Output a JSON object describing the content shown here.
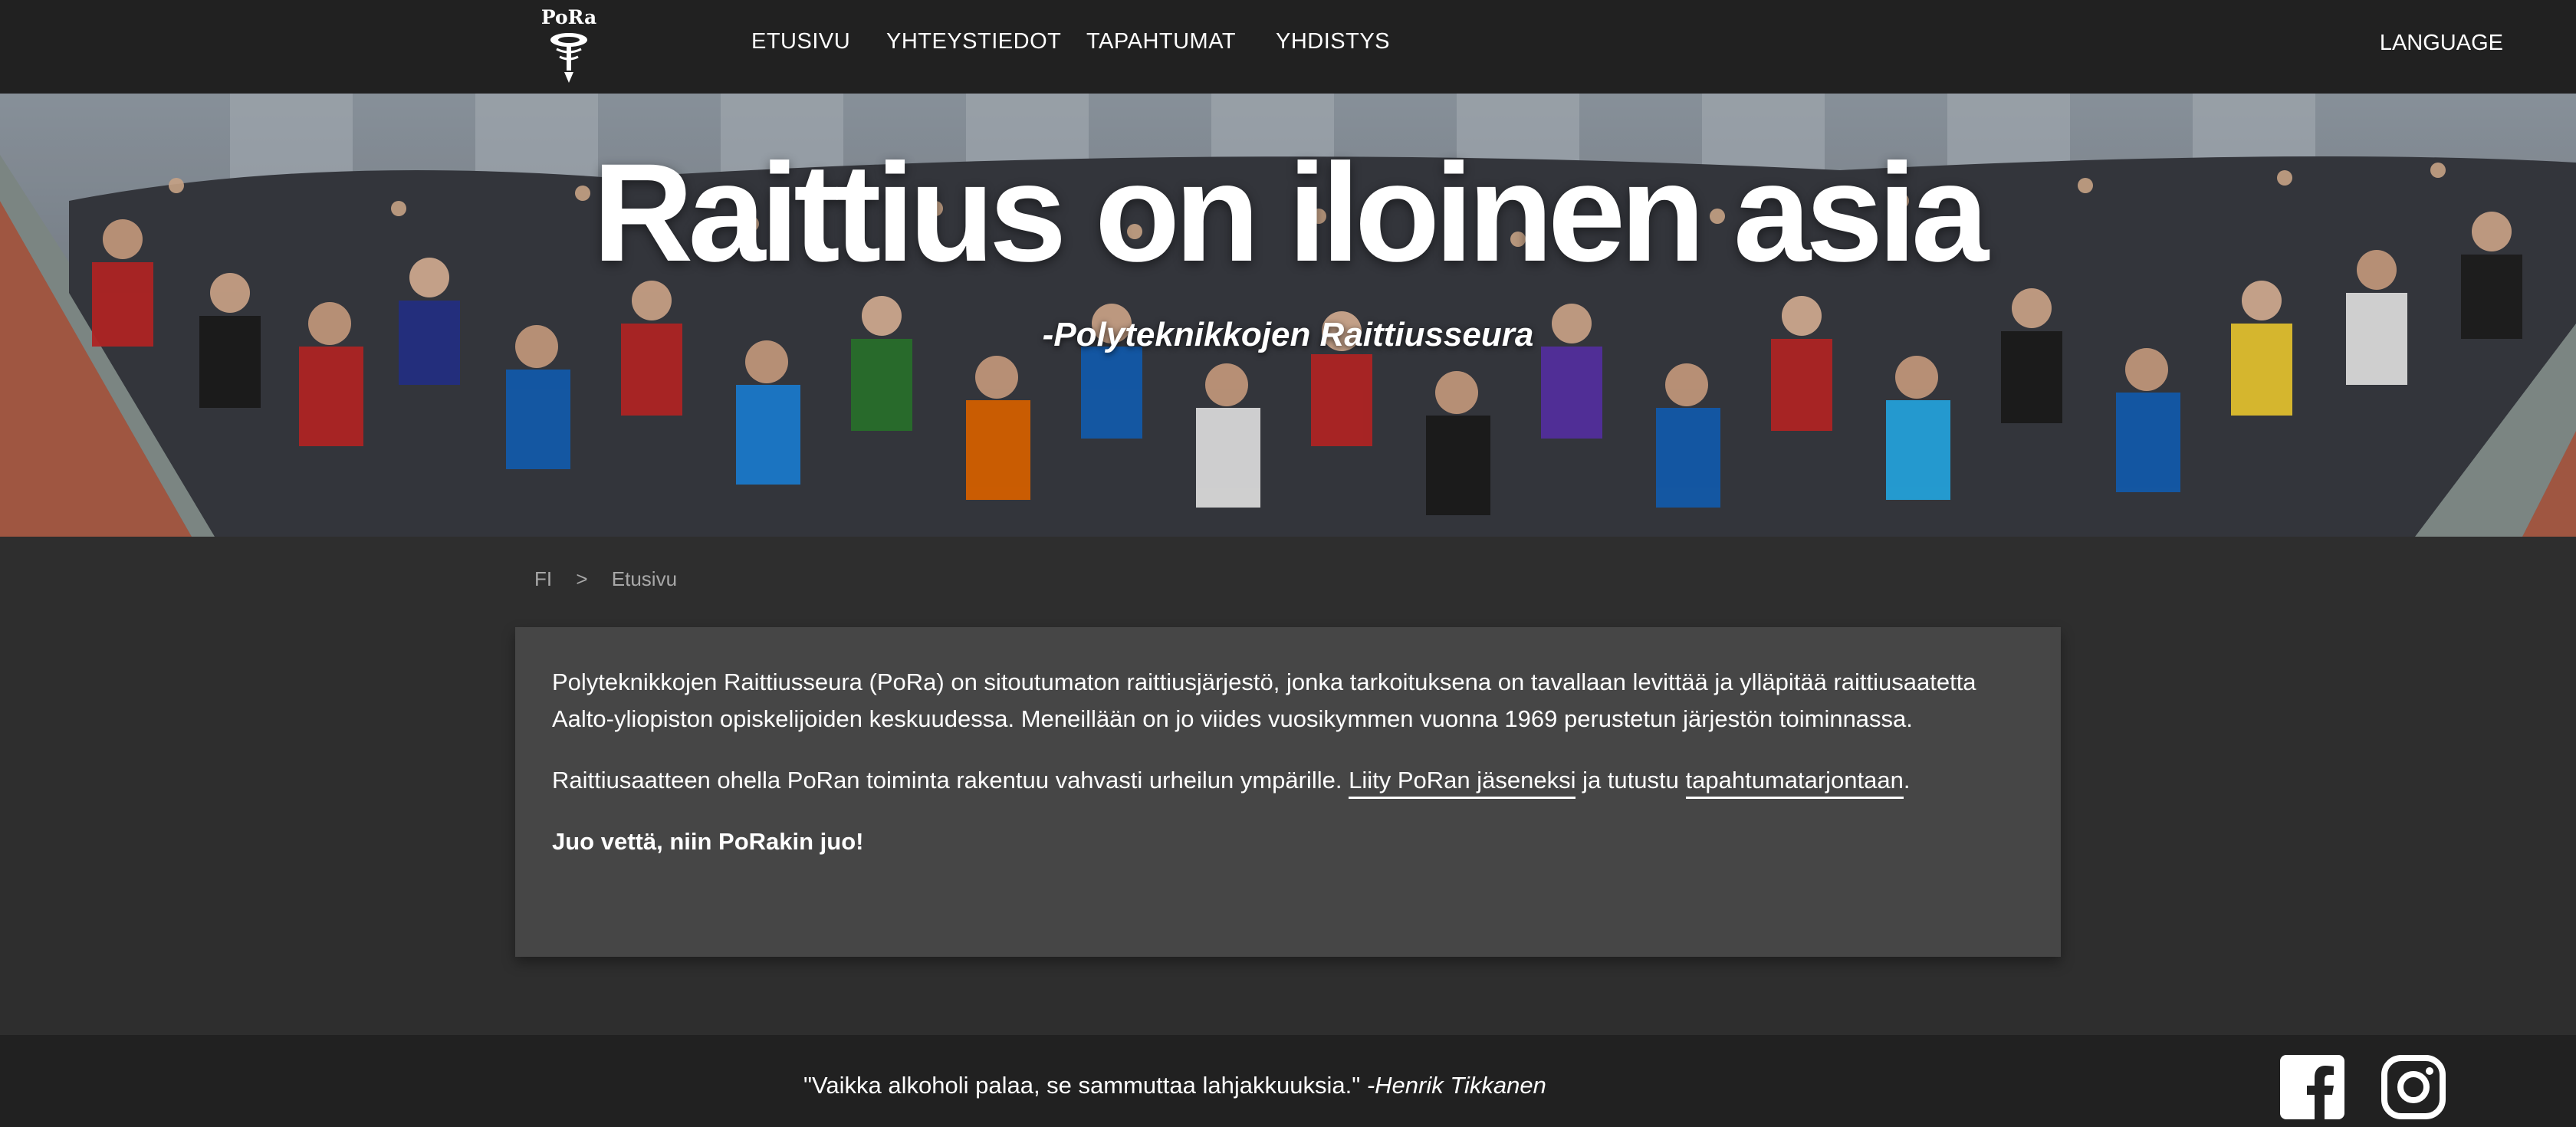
{
  "logo": {
    "text": "PoRa"
  },
  "nav": {
    "items": [
      {
        "label": "ETUSIVU"
      },
      {
        "label": "YHTEYSTIEDOT"
      },
      {
        "label": "TAPAHTUMAT"
      },
      {
        "label": "YHDISTYS"
      }
    ],
    "language_label": "LANGUAGE"
  },
  "hero": {
    "title": "Raittius on iloinen asia",
    "subtitle": "-Polyteknikkojen Raittiusseura"
  },
  "breadcrumb": {
    "root": "FI",
    "separator": ">",
    "current": "Etusivu"
  },
  "content": {
    "paragraph1": "Polyteknikkojen Raittiusseura (PoRa) on sitoutumaton raittiusjärjestö, jonka tarkoituksena on tavallaan levittää ja ylläpitää raittiusaatetta Aalto-yliopiston opiskelijoiden keskuudessa. Meneillään on jo viides vuosikymmen vuonna 1969 perustetun järjestön toiminnassa.",
    "paragraph2_prefix": "Raittiusaatteen ohella PoRan toiminta rakentuu vahvasti urheilun ympärille. ",
    "link_join": "Liity PoRan jäseneksi",
    "paragraph2_middle": " ja tutustu ",
    "link_events": "tapahtumatarjontaan",
    "paragraph2_suffix": ".",
    "motto": "Juo vettä, niin PoRakin juo!"
  },
  "footer": {
    "quote": "\"Vaikka alkoholi palaa, se sammuttaa lahjakkuuksia.\"",
    "quote_author": "-Henrik Tikkanen",
    "social_icons": [
      "facebook-icon",
      "instagram-icon"
    ]
  },
  "colors": {
    "nav_bg": "#212121",
    "page_bg": "#2e2e2e",
    "card_bg": "#464646",
    "text": "#ffffff",
    "breadcrumb_text": "#a8a8a8"
  }
}
